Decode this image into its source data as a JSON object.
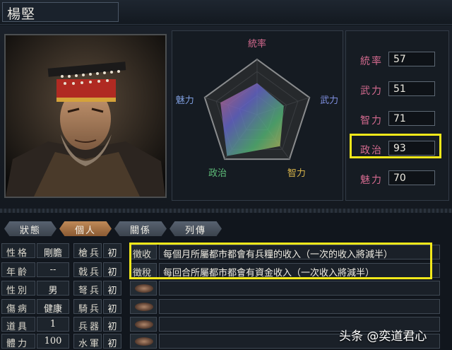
{
  "character": {
    "name": "楊堅"
  },
  "radar": {
    "axes": [
      "統率",
      "武力",
      "智力",
      "政治",
      "魅力"
    ],
    "values": [
      57,
      51,
      71,
      93,
      70
    ]
  },
  "stats": [
    {
      "label": "統率",
      "value": "57"
    },
    {
      "label": "武力",
      "value": "51"
    },
    {
      "label": "智力",
      "value": "71"
    },
    {
      "label": "政治",
      "value": "93"
    },
    {
      "label": "魅力",
      "value": "70"
    }
  ],
  "tabs": [
    {
      "label": "狀態",
      "active": false
    },
    {
      "label": "個人",
      "active": true
    },
    {
      "label": "關係",
      "active": false
    },
    {
      "label": "列傳",
      "active": false
    }
  ],
  "personal": [
    {
      "label": "性格",
      "value": "剛膽"
    },
    {
      "label": "年齡",
      "value": "--"
    },
    {
      "label": "性別",
      "value": "男"
    },
    {
      "label": "傷病",
      "value": "健康"
    },
    {
      "label": "道具",
      "value": "1"
    },
    {
      "label": "體力",
      "value": "100"
    }
  ],
  "troops": [
    {
      "label": "槍兵",
      "value": "初"
    },
    {
      "label": "戟兵",
      "value": "初"
    },
    {
      "label": "弩兵",
      "value": "初"
    },
    {
      "label": "騎兵",
      "value": "初"
    },
    {
      "label": "兵器",
      "value": "初"
    },
    {
      "label": "水軍",
      "value": "初"
    }
  ],
  "skills": [
    {
      "name": "徵收",
      "desc": "每個月所屬都市都會有兵糧的收入（一次的收入將減半）"
    },
    {
      "name": "徵稅",
      "desc": "每回合所屬都市都會有資金收入（一次收入將減半）"
    },
    {
      "name": "",
      "desc": ""
    },
    {
      "name": "",
      "desc": ""
    },
    {
      "name": "",
      "desc": ""
    },
    {
      "name": "",
      "desc": ""
    }
  ],
  "watermark": "头条 @奕道君心",
  "colors": {
    "highlight": "#f2e81a",
    "stat_label": "#d46a8f"
  }
}
